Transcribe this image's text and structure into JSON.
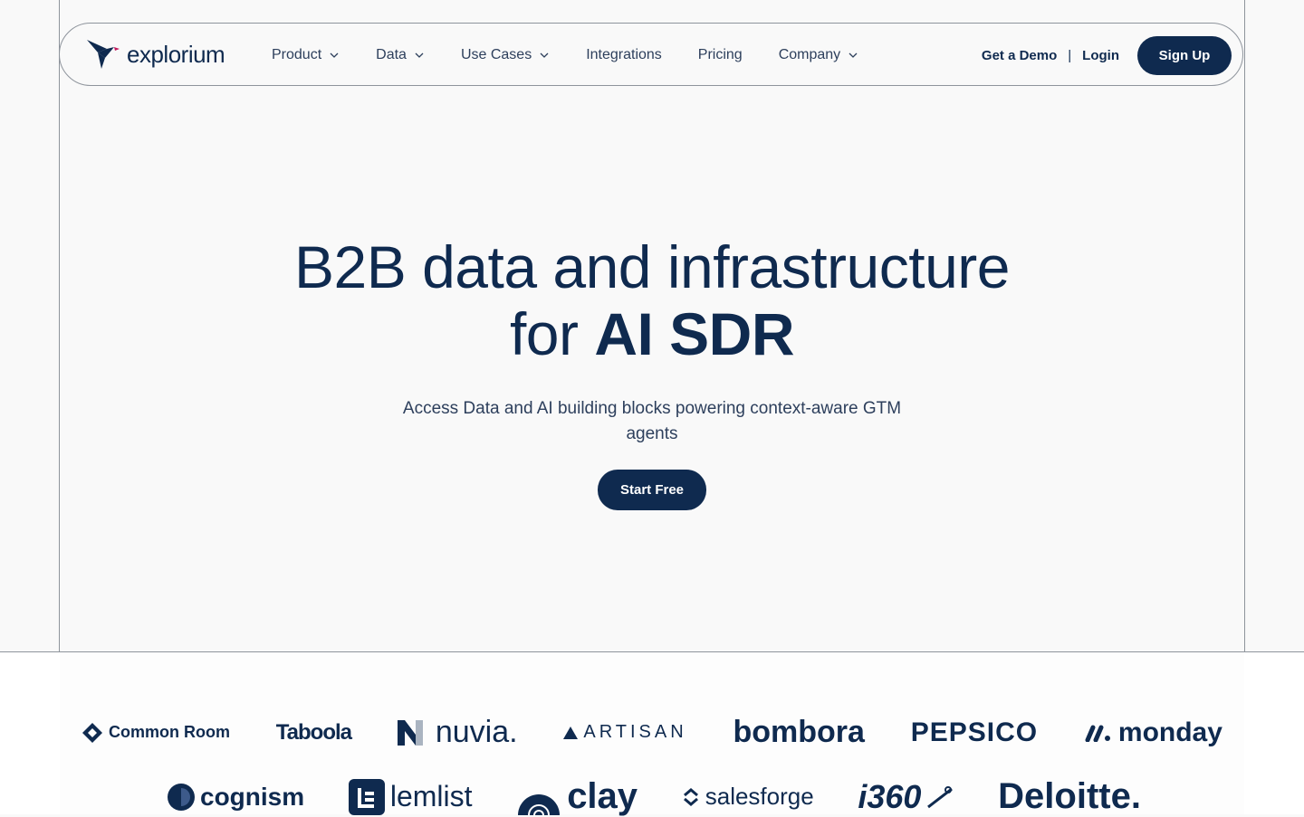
{
  "brand": {
    "name": "explorium",
    "color": "#0f2a4f",
    "accent": "#c2185b"
  },
  "nav": {
    "items": [
      {
        "label": "Product",
        "has_dropdown": true
      },
      {
        "label": "Data",
        "has_dropdown": true
      },
      {
        "label": "Use Cases",
        "has_dropdown": true
      },
      {
        "label": "Integrations",
        "has_dropdown": false
      },
      {
        "label": "Pricing",
        "has_dropdown": false
      },
      {
        "label": "Company",
        "has_dropdown": true
      }
    ],
    "demo_label": "Get a Demo",
    "separator": "|",
    "login_label": "Login",
    "signup_label": "Sign Up"
  },
  "hero": {
    "line1": "B2B data and infrastructure",
    "line2_prefix": "for ",
    "line2_bold": "AI SDR",
    "subtitle": "Access Data and AI building blocks powering context-aware GTM agents",
    "cta_label": "Start Free"
  },
  "logos": {
    "row1": [
      "Common Room",
      "Taboola",
      "nuvia.",
      "ARTISAN",
      "bombora",
      "PEPSICO",
      "monday"
    ],
    "row2": [
      "cognism",
      "lemlist",
      "clay",
      "salesforge",
      "i360",
      "Deloitte."
    ]
  }
}
